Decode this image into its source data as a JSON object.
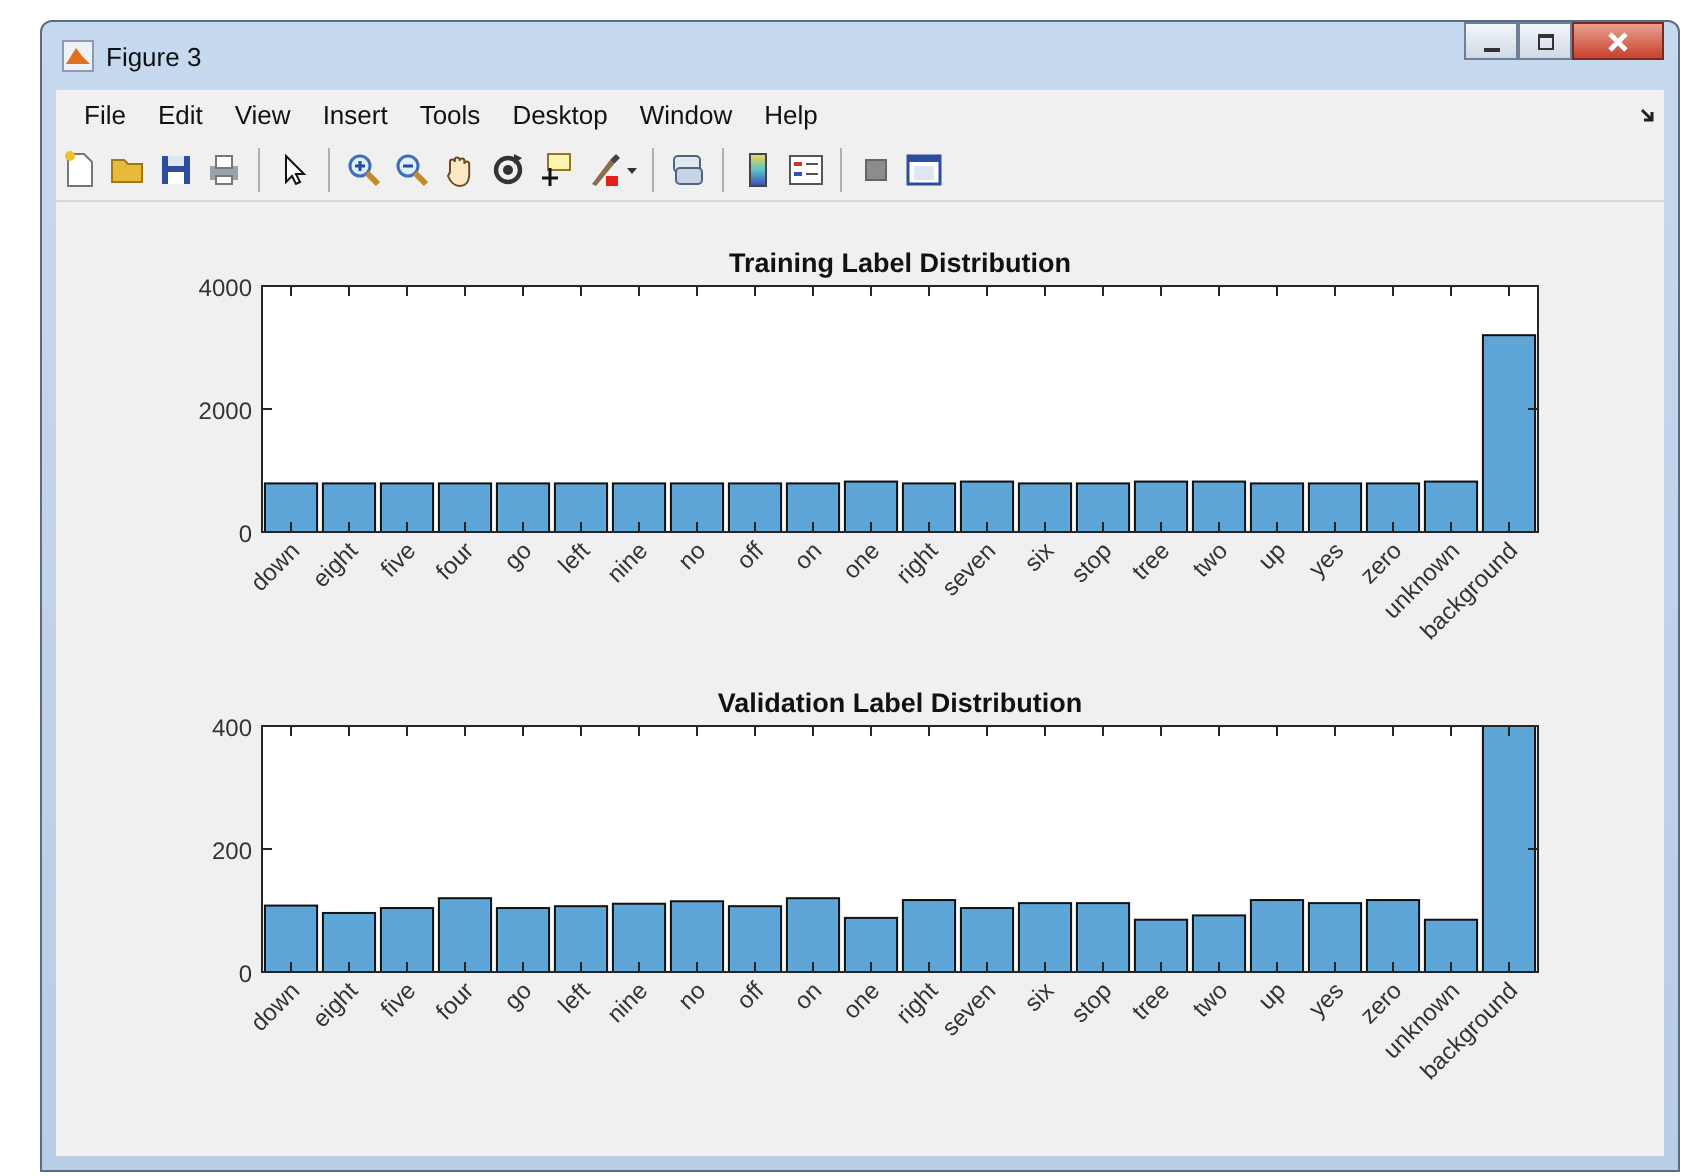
{
  "window": {
    "title": "Figure 3"
  },
  "menu": [
    "File",
    "Edit",
    "View",
    "Insert",
    "Tools",
    "Desktop",
    "Window",
    "Help"
  ],
  "charts": [
    {
      "chart_data": {
        "type": "bar",
        "title": "Training Label Distribution",
        "categories": [
          "down",
          "eight",
          "five",
          "four",
          "go",
          "left",
          "nine",
          "no",
          "off",
          "on",
          "one",
          "right",
          "seven",
          "six",
          "stop",
          "tree",
          "two",
          "up",
          "yes",
          "zero",
          "unknown",
          "background"
        ],
        "values": [
          790,
          790,
          790,
          790,
          790,
          790,
          790,
          790,
          790,
          790,
          820,
          790,
          820,
          790,
          790,
          820,
          820,
          790,
          790,
          790,
          820,
          3200
        ],
        "ylim": [
          0,
          4000
        ],
        "yticks": [
          0,
          2000,
          4000
        ]
      }
    },
    {
      "chart_data": {
        "type": "bar",
        "title": "Validation Label Distribution",
        "categories": [
          "down",
          "eight",
          "five",
          "four",
          "go",
          "left",
          "nine",
          "no",
          "off",
          "on",
          "one",
          "right",
          "seven",
          "six",
          "stop",
          "tree",
          "two",
          "up",
          "yes",
          "zero",
          "unknown",
          "background"
        ],
        "values": [
          108,
          96,
          104,
          120,
          104,
          107,
          111,
          115,
          107,
          120,
          88,
          117,
          104,
          112,
          112,
          85,
          92,
          117,
          112,
          117,
          85,
          400
        ],
        "ylim": [
          0,
          400
        ],
        "yticks": [
          0,
          200,
          400
        ]
      }
    }
  ]
}
